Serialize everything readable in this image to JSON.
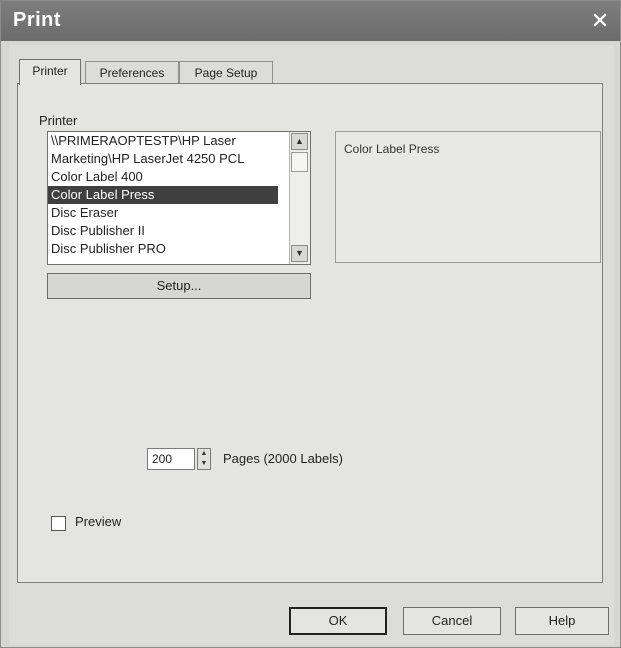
{
  "window": {
    "title": "Print",
    "close_glyph": "✕"
  },
  "tabs": [
    {
      "label": "Printer",
      "active": true
    },
    {
      "label": "Preferences",
      "active": false
    },
    {
      "label": "Page Setup",
      "active": false
    }
  ],
  "printer": {
    "label": "Printer",
    "items": [
      "\\\\PRIMERAOPTESTP\\HP Laser",
      "Marketing\\HP LaserJet 4250 PCL",
      "Color Label 400",
      "Color Label Press",
      "Disc Eraser",
      "Disc Publisher II",
      "Disc Publisher PRO"
    ],
    "selected_index": 3,
    "scroll_up_glyph": "▲",
    "scroll_down_glyph": "▼",
    "info": "Color Label Press",
    "setup_label": "Setup..."
  },
  "pages": {
    "value": "200",
    "spin_up_glyph": "▲",
    "spin_down_glyph": "▼",
    "label": "Pages (2000 Labels)"
  },
  "preview": {
    "label": "Preview",
    "checked": false
  },
  "buttons": {
    "ok": "OK",
    "cancel": "Cancel",
    "help": "Help"
  },
  "icons": {
    "close": "close-icon",
    "scroll_up": "chevron-up-icon",
    "scroll_down": "chevron-down-icon"
  }
}
